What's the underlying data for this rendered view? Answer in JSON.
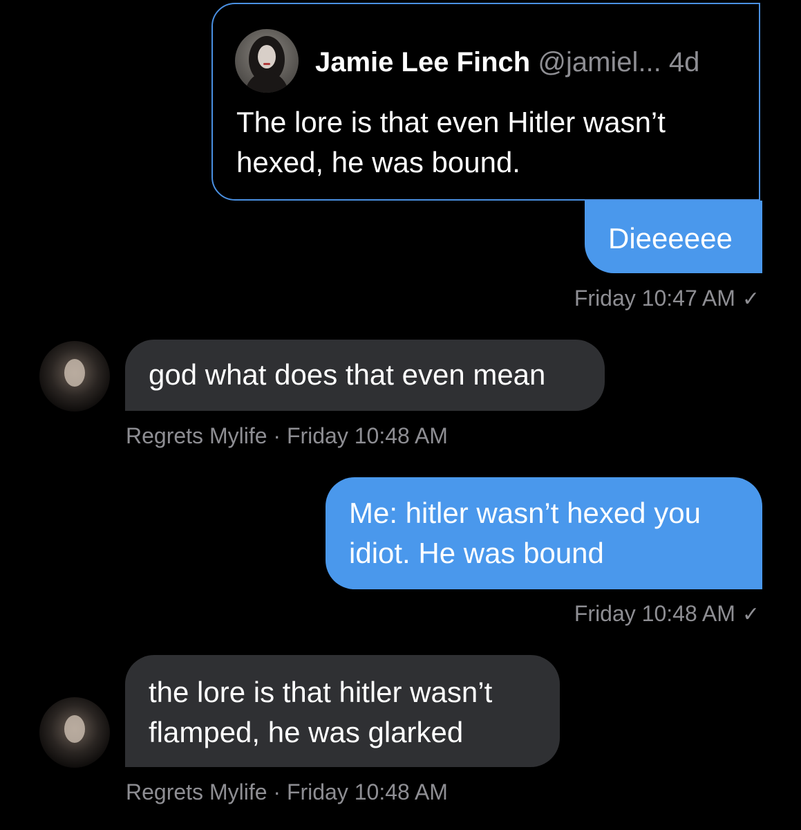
{
  "quoted_tweet": {
    "author_name": "Jamie Lee Finch",
    "author_handle": "@jamiel...",
    "age": "4d",
    "text": "The lore is that even Hitler wasn’t hexed, he was bound."
  },
  "messages": [
    {
      "direction": "sent",
      "text": "Dieeeeee",
      "meta": "Friday 10:47 AM",
      "read_icon": "checkmark-icon"
    },
    {
      "direction": "received",
      "text": "god what does that even mean",
      "meta": "Regrets Mylife · Friday 10:48 AM"
    },
    {
      "direction": "sent",
      "text": "Me: hitler wasn’t hexed you idiot. He was bound",
      "meta": "Friday 10:48 AM",
      "read_icon": "checkmark-icon"
    },
    {
      "direction": "received",
      "text": "the lore is that hitler wasn’t flamped, he was glarked",
      "meta": "Regrets Mylife · Friday 10:48 AM"
    }
  ],
  "colors": {
    "background": "#000000",
    "sent_bubble": "#4a98ec",
    "received_bubble": "#2f3033",
    "quote_border": "#4a90e2",
    "meta_text": "#8e8e93"
  }
}
